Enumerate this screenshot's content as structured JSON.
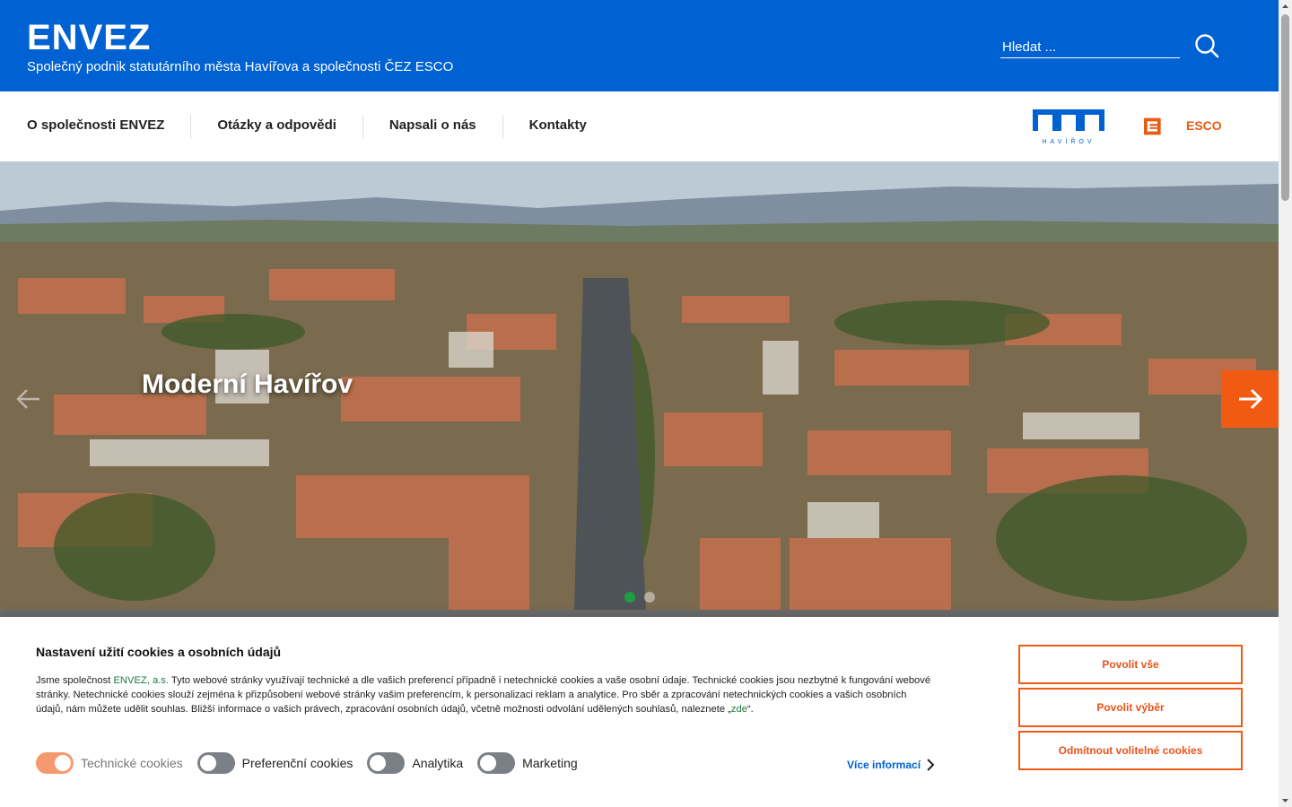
{
  "header": {
    "brand": "ENVEZ",
    "tagline": "Společný podnik statutárního města Havířova a společnosti ČEZ ESCO",
    "search_placeholder": "Hledat ..."
  },
  "nav": {
    "items": [
      "O společnosti ENVEZ",
      "Otázky a odpovědi",
      "Napsali o nás",
      "Kontakty"
    ],
    "logo_havirov_text": "HAVÍŘOV",
    "logo_esco_text": "ESCO"
  },
  "hero": {
    "title": "Moderní Havířov",
    "slides": 2,
    "active_slide": 1
  },
  "cookies": {
    "title": "Nastavení užití cookies a osobních údajů",
    "text_prefix": "Jsme společnost ",
    "company": "ENVEZ, a.s.",
    "text_body": " Tyto webové stránky využívají technické a dle vašich preferencí případně i netechnické cookies a vaše osobní údaje. Technické cookies jsou nezbytné k fungování webové stránky. Netechnické cookies slouží zejména k přizpůsobení webové stránky vašim preferencím, k personalizaci reklam a analytice. Pro sběr a zpracování netechnických cookies a vašich osobních údajů, nám můžete udělit souhlas. Bližší informace o vašich právech, zpracování osobních údajů, včetně možnosti odvolání udělených souhlasů, naleznete „",
    "here_link": "zde",
    "text_suffix": "“.",
    "toggles": {
      "technical": "Technické cookies",
      "preference": "Preferenční cookies",
      "analytics": "Analytika",
      "marketing": "Marketing"
    },
    "more_info": "Více informací",
    "btn_allow_all": "Povolit vše",
    "btn_allow_selection": "Povolit výběr",
    "btn_reject": "Odmítnout volitelné cookies"
  },
  "colors": {
    "header_blue": "#0061d2",
    "accent_orange": "#f05a12",
    "toggle_on": "#f59a6e"
  }
}
